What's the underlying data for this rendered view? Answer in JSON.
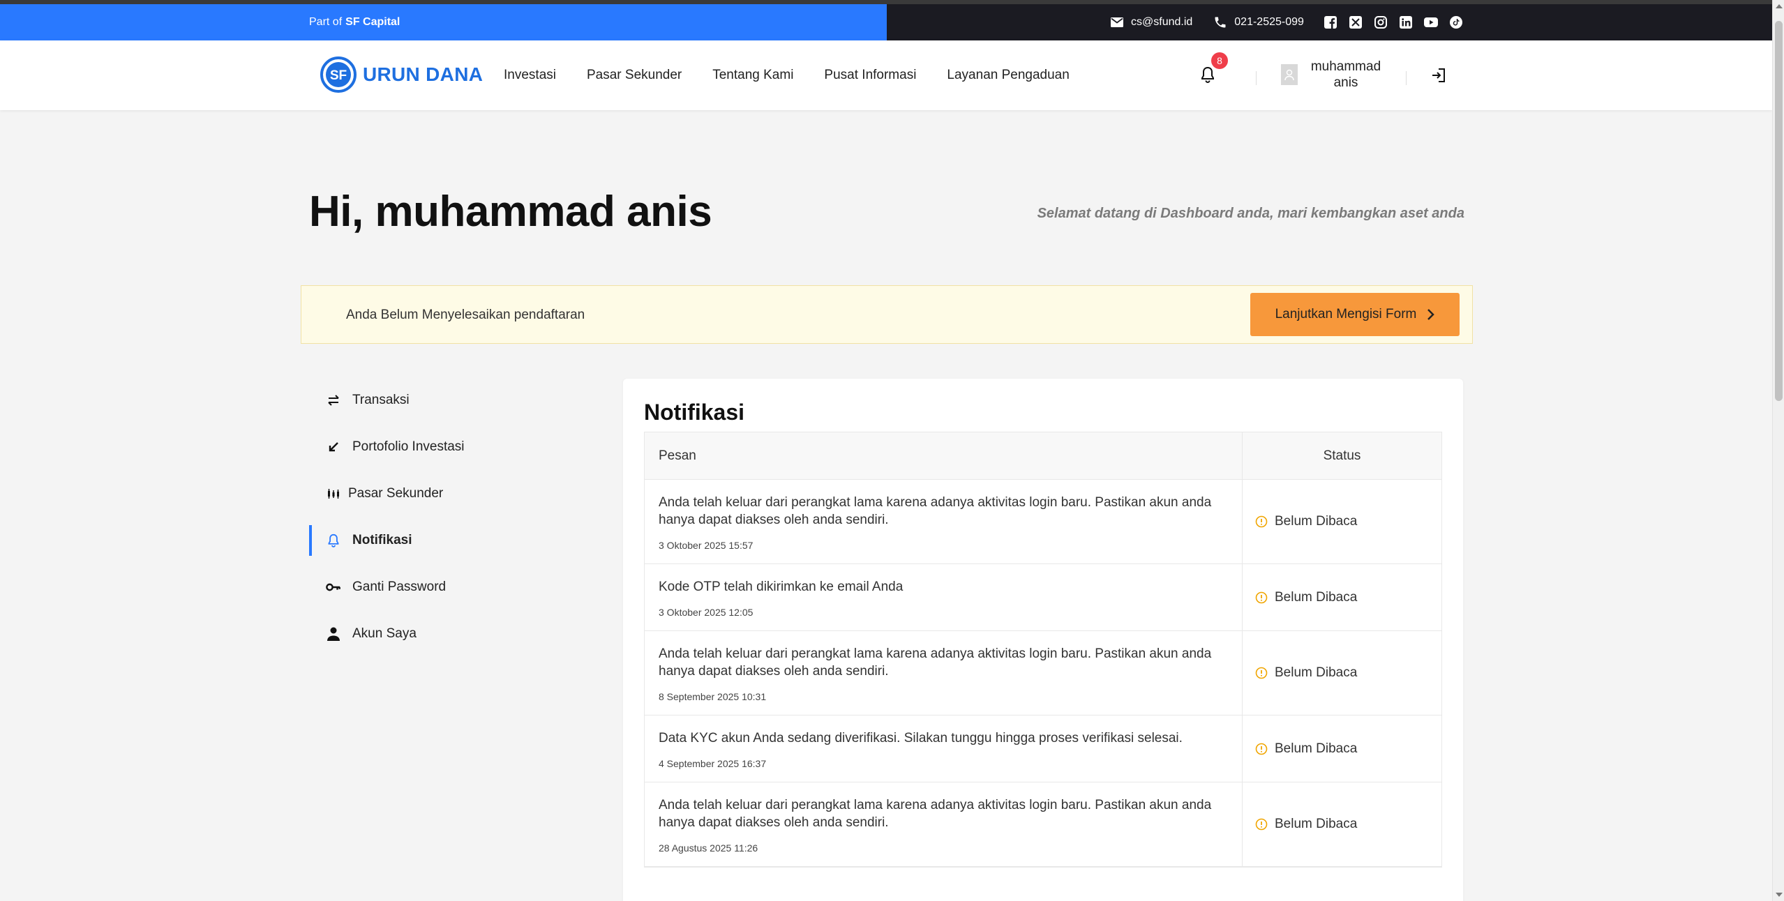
{
  "topbar": {
    "part_of": "Part of",
    "brand": "SF Capital",
    "email": "cs@sfund.id",
    "phone": "021-2525-099",
    "socials": [
      "facebook-icon",
      "x-icon",
      "instagram-icon",
      "linkedin-icon",
      "youtube-icon",
      "tiktok-icon"
    ]
  },
  "navbar": {
    "logo_mark": "SF",
    "logo_text": "URUN DANA",
    "links": [
      "Investasi",
      "Pasar Sekunder",
      "Tentang Kami",
      "Pusat Informasi",
      "Layanan Pengaduan"
    ],
    "notification_count": "8",
    "user_name": "muhammad anis"
  },
  "hero": {
    "greeting": "Hi, muhammad anis",
    "subtitle": "Selamat datang di Dashboard anda, mari kembangkan aset anda"
  },
  "alert": {
    "message": "Anda Belum Menyelesaikan pendaftaran",
    "button_label": "Lanjutkan Mengisi Form"
  },
  "sidebar": {
    "items": [
      {
        "label": "Transaksi",
        "icon": "swap-icon"
      },
      {
        "label": "Portofolio Investasi",
        "icon": "arrow-down-left-icon"
      },
      {
        "label": "Pasar Sekunder",
        "icon": "candlestick-icon"
      },
      {
        "label": "Notifikasi",
        "icon": "bell-icon",
        "active": true
      },
      {
        "label": "Ganti Password",
        "icon": "key-icon"
      },
      {
        "label": "Akun Saya",
        "icon": "person-icon"
      }
    ]
  },
  "notifications": {
    "title": "Notifikasi",
    "col_message": "Pesan",
    "col_status": "Status",
    "rows": [
      {
        "message": "Anda telah keluar dari perangkat lama karena adanya aktivitas login baru. Pastikan akun anda hanya dapat diakses oleh anda sendiri.",
        "date": "3 Oktober 2025 15:57",
        "status": "Belum Dibaca"
      },
      {
        "message": "Kode OTP telah dikirimkan ke email Anda",
        "date": "3 Oktober 2025 12:05",
        "status": "Belum Dibaca"
      },
      {
        "message": "Anda telah keluar dari perangkat lama karena adanya aktivitas login baru. Pastikan akun anda hanya dapat diakses oleh anda sendiri.",
        "date": "8 September 2025 10:31",
        "status": "Belum Dibaca"
      },
      {
        "message": "Data KYC akun Anda sedang diverifikasi. Silakan tunggu hingga proses verifikasi selesai.",
        "date": "4 September 2025 16:37",
        "status": "Belum Dibaca"
      },
      {
        "message": "Anda telah keluar dari perangkat lama karena adanya aktivitas login baru. Pastikan akun anda hanya dapat diakses oleh anda sendiri.",
        "date": "28 Agustus 2025 11:26",
        "status": "Belum Dibaca"
      }
    ]
  },
  "colors": {
    "primary": "#2979ff",
    "topbar_dark": "#1b1b22",
    "cta_orange": "#f7983b",
    "alert_bg": "#fefbe6",
    "status_warning": "#f0a500",
    "badge_red": "#ef3e4a"
  }
}
